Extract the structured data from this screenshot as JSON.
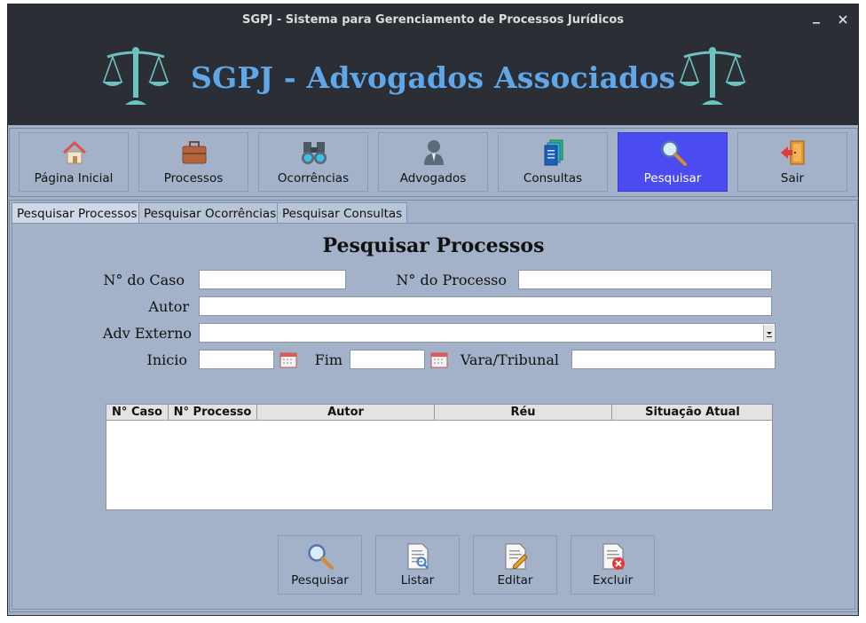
{
  "window": {
    "title": "SGPJ - Sistema para Gerenciamento de Processos Jurídicos",
    "minimize_glyph": "⚊",
    "close_glyph": "✕"
  },
  "banner": {
    "title": "SGPJ - Advogados Associados",
    "icon": "scales-of-justice-icon",
    "accent": "#5fa7e8"
  },
  "nav": {
    "items": [
      {
        "label": "Página Inicial",
        "icon": "home-icon"
      },
      {
        "label": "Processos",
        "icon": "briefcase-icon"
      },
      {
        "label": "Ocorrências",
        "icon": "binoculars-icon"
      },
      {
        "label": "Advogados",
        "icon": "person-icon"
      },
      {
        "label": "Consultas",
        "icon": "documents-icon"
      },
      {
        "label": "Pesquisar",
        "icon": "magnifier-icon",
        "active": true
      },
      {
        "label": "Sair",
        "icon": "exit-door-icon"
      }
    ],
    "active_color": "#4a4cf2"
  },
  "tabs": [
    {
      "label": "Pesquisar Processos",
      "active": true
    },
    {
      "label": "Pesquisar Ocorrências"
    },
    {
      "label": "Pesquisar Consultas"
    }
  ],
  "form": {
    "title": "Pesquisar Processos",
    "labels": {
      "numero_caso": "N° do Caso",
      "numero_processo": "N° do Processo",
      "autor": "Autor",
      "adv_externo": "Adv Externo",
      "inicio": "Inicio",
      "fim": "Fim",
      "vara_tribunal": "Vara/Tribunal"
    },
    "values": {
      "numero_caso": "",
      "numero_processo": "",
      "autor": "",
      "adv_externo": "",
      "inicio": "",
      "fim": "",
      "vara_tribunal": ""
    }
  },
  "table": {
    "columns": [
      "N° Caso",
      "N° Processo",
      "Autor",
      "Réu",
      "Situação Atual"
    ],
    "rows": []
  },
  "actions": [
    {
      "label": "Pesquisar",
      "icon": "magnifier-icon"
    },
    {
      "label": "Listar",
      "icon": "document-list-icon"
    },
    {
      "label": "Editar",
      "icon": "document-edit-icon"
    },
    {
      "label": "Excluir",
      "icon": "document-delete-icon"
    }
  ]
}
